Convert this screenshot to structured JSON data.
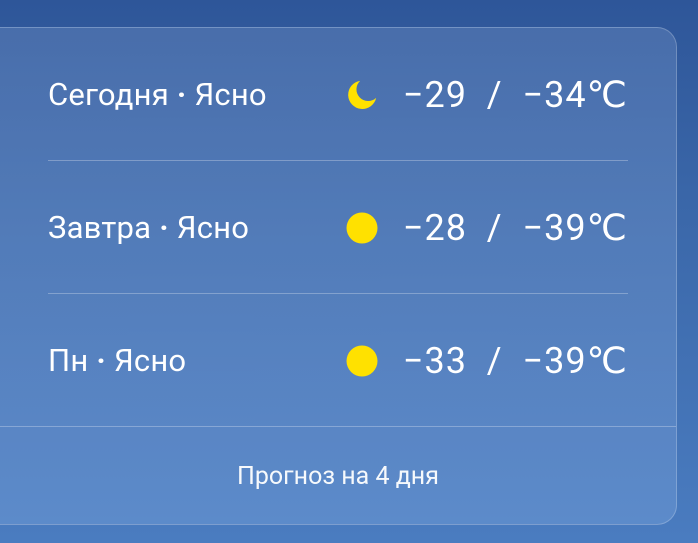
{
  "forecast": {
    "rows": [
      {
        "day": "Сегодня",
        "separator": "·",
        "condition": "Ясно",
        "icon": "moon-icon",
        "temp": "−29  /  −34℃"
      },
      {
        "day": "Завтра",
        "separator": "·",
        "condition": "Ясно",
        "icon": "sun-icon",
        "temp": "−28  /  −39℃"
      },
      {
        "day": "Пн",
        "separator": "·",
        "condition": "Ясно",
        "icon": "sun-icon",
        "temp": "−33  /  −39℃"
      }
    ],
    "footer_label": "Прогноз на 4 дня"
  },
  "colors": {
    "icon": "#FFE100",
    "background": "#3b68aa"
  }
}
